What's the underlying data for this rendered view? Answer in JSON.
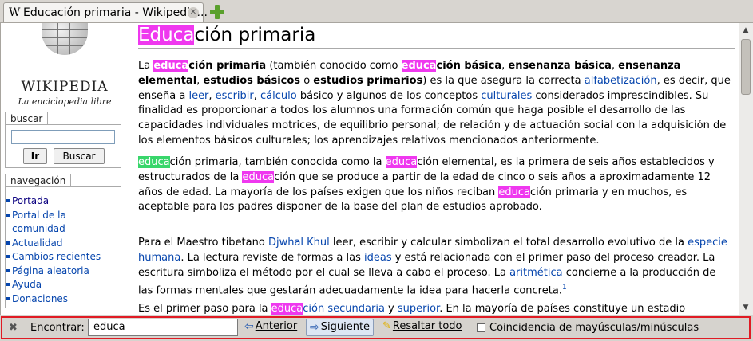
{
  "tab": {
    "favicon": "W",
    "title": "Educación primaria - Wikipedia...",
    "close": "✕"
  },
  "sidebar": {
    "logo_word": "WIKIPEDIA",
    "logo_tagline": "La enciclopedia libre",
    "search_label": "buscar",
    "search_value": "",
    "go_button": "Ir",
    "search_button": "Buscar",
    "nav_label": "navegación",
    "nav_items": [
      "Portada",
      "Portal de la",
      "comunidad",
      "Actualidad",
      "Cambios recientes",
      "Página aleatoria",
      "Ayuda",
      "Donaciones"
    ]
  },
  "article": {
    "title_hl": "Educa",
    "title_rest": "ción primaria"
  },
  "p1": {
    "t1": "La ",
    "h1": "educa",
    "b1": "ción primaria",
    "t2": " (también conocido como ",
    "h2": "educa",
    "b2": "ción básica",
    "t3": ", ",
    "b3": "enseñanza básica",
    "t4": ", ",
    "b4": "enseñanza elemental",
    "t5": ", ",
    "b5": "estudios básicos",
    "t6": " o ",
    "b6": "estudios primarios",
    "t7": ") es la que asegura la correcta ",
    "l1": "alfabetización",
    "t8": ", es decir, que enseña a ",
    "l2": "leer",
    "t9": ", ",
    "l3": "escribir",
    "t10": ", ",
    "l4": "cálculo",
    "t11": " básico y algunos de los conceptos ",
    "l5": "culturales",
    "t12": " considerados imprescindibles. Su finalidad es proporcionar a todos los alumnos una formación común que haga posible el desarrollo de las capacidades individuales motrices, de equilibrio personal; de relación y de actuación social con la adquisición de los elementos básicos culturales; los aprendizajes relativos mencionados anteriormente."
  },
  "p2": {
    "h1": "educa",
    "t1": "ción primaria, también conocida como la ",
    "h2": "educa",
    "t2": "ción elemental, es la primera de seis años establecidos y estructurados de la ",
    "h3": "educa",
    "t3": "ción que se produce a partir de la edad de cinco o seis años a aproximadamente 12 años de edad. La mayoría de los países exigen que los niños reciban ",
    "h4": "educa",
    "t4": "ción primaria y en muchos, es aceptable para los padres disponer de la base del plan de estudios aprobado."
  },
  "p3": {
    "t1": "Para el Maestro tibetano ",
    "l1": "Djwhal Khul",
    "t2": " leer, escribir y calcular simbolizan el total desarrollo evolutivo de la ",
    "l2": "especie humana",
    "t3": ". La lectura reviste de formas a las ",
    "l3": "ideas",
    "t4": " y está relacionada con el primer paso del proceso creador. La escritura simboliza el método por el cual se lleva a cabo el proceso. La ",
    "l4": "aritmética",
    "t5": " concierne a la producción de las formas mentales que gestarán adecuadamente la idea para hacerla concreta.",
    "sup": "1"
  },
  "p4": {
    "t1": "Es el primer paso para la ",
    "h1": "educa",
    "l1": "ción secundaria",
    "t2": " y ",
    "l2": "superior",
    "t3": ". En la mayoría de países constituye un estadio"
  },
  "findbar": {
    "label": "Encontrar:",
    "query": "educa",
    "prev": "Anterior",
    "next": "Siguiente",
    "highlight": "Resaltar todo",
    "match_case": "Coincidencia de mayúsculas/minúsculas",
    "frame_color": "#e01b24"
  },
  "colors": {
    "highlight": "#ef38ef",
    "current_match": "#38d66b",
    "link": "#0645ad"
  }
}
